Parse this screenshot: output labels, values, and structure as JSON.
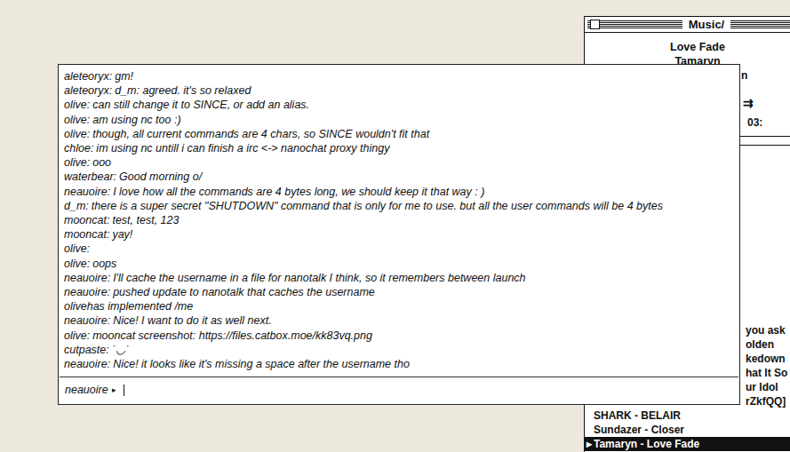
{
  "chat": {
    "messages": [
      {
        "nick": "aleteoryx:",
        "text": "gm!",
        "kind": "message"
      },
      {
        "nick": "aleteoryx:",
        "text": "d_m: agreed. it's so relaxed",
        "kind": "message"
      },
      {
        "nick": "olive:",
        "text": "can still change it to SINCE, or add an alias.",
        "kind": "message"
      },
      {
        "nick": "olive:",
        "text": "am using nc too :)",
        "kind": "message"
      },
      {
        "nick": "olive:",
        "text": "though, all current commands are 4 chars, so SINCE wouldn't fit that",
        "kind": "message"
      },
      {
        "nick": "chloe:",
        "text": "im using nc untill i can finish a irc <-> nanochat proxy thingy",
        "kind": "message"
      },
      {
        "nick": "olive:",
        "text": "ooo",
        "kind": "message"
      },
      {
        "nick": "waterbear:",
        "text": "Good morning o/",
        "kind": "message"
      },
      {
        "nick": "neauoire:",
        "text": "I love how all the commands are 4 bytes long, we should keep it that way : )",
        "kind": "message"
      },
      {
        "nick": "d_m:",
        "text": "there is a super secret \"SHUTDOWN\" command that is only for me to use. but all the user commands will be 4 bytes",
        "kind": "message"
      },
      {
        "nick": "mooncat:",
        "text": "test, test, 123",
        "kind": "message"
      },
      {
        "nick": "mooncat:",
        "text": "yay!",
        "kind": "message"
      },
      {
        "nick": "olive:",
        "text": "",
        "kind": "message"
      },
      {
        "nick": "olive:",
        "text": "oops",
        "kind": "message"
      },
      {
        "nick": "neauoire:",
        "text": "I'll cache the username in a file for nanotalk I think, so it remembers between launch",
        "kind": "message"
      },
      {
        "nick": "neauoire:",
        "text": "pushed update to nanotalk that caches the username",
        "kind": "message"
      },
      {
        "nick": "olive",
        "text": "has implemented /me",
        "kind": "action"
      },
      {
        "nick": "neauoire:",
        "text": "Nice! I want to do it as well next.",
        "kind": "message"
      },
      {
        "nick": "olive:",
        "text": "mooncat screenshot: https://files.catbox.moe/kk83vq.png",
        "kind": "message"
      },
      {
        "nick": "cutpaste:",
        "text": "˙◡˙",
        "kind": "message"
      },
      {
        "nick": "neauoire:",
        "text": "Nice! it looks like it's missing a space after the username tho",
        "kind": "message"
      }
    ],
    "input": {
      "nick": "neauoire",
      "prompt": "▸",
      "value": ""
    }
  },
  "music": {
    "title": "Music/",
    "now_playing": {
      "title": "Love Fade",
      "artist": "Tamaryn",
      "album": "n"
    },
    "shuffle_icon": "⇉",
    "time": "03:",
    "playlist": {
      "marker": "▸",
      "partial_rows": [
        "you ask",
        "olden",
        "kedown",
        "hat It So",
        "ur Idol",
        "rZkfQQ]"
      ],
      "rows": [
        {
          "label": "SHARK - BELAIR",
          "selected": false
        },
        {
          "label": "Sundazer - Closer",
          "selected": false
        },
        {
          "label": "Tamaryn - Love Fade",
          "selected": true
        }
      ]
    }
  }
}
